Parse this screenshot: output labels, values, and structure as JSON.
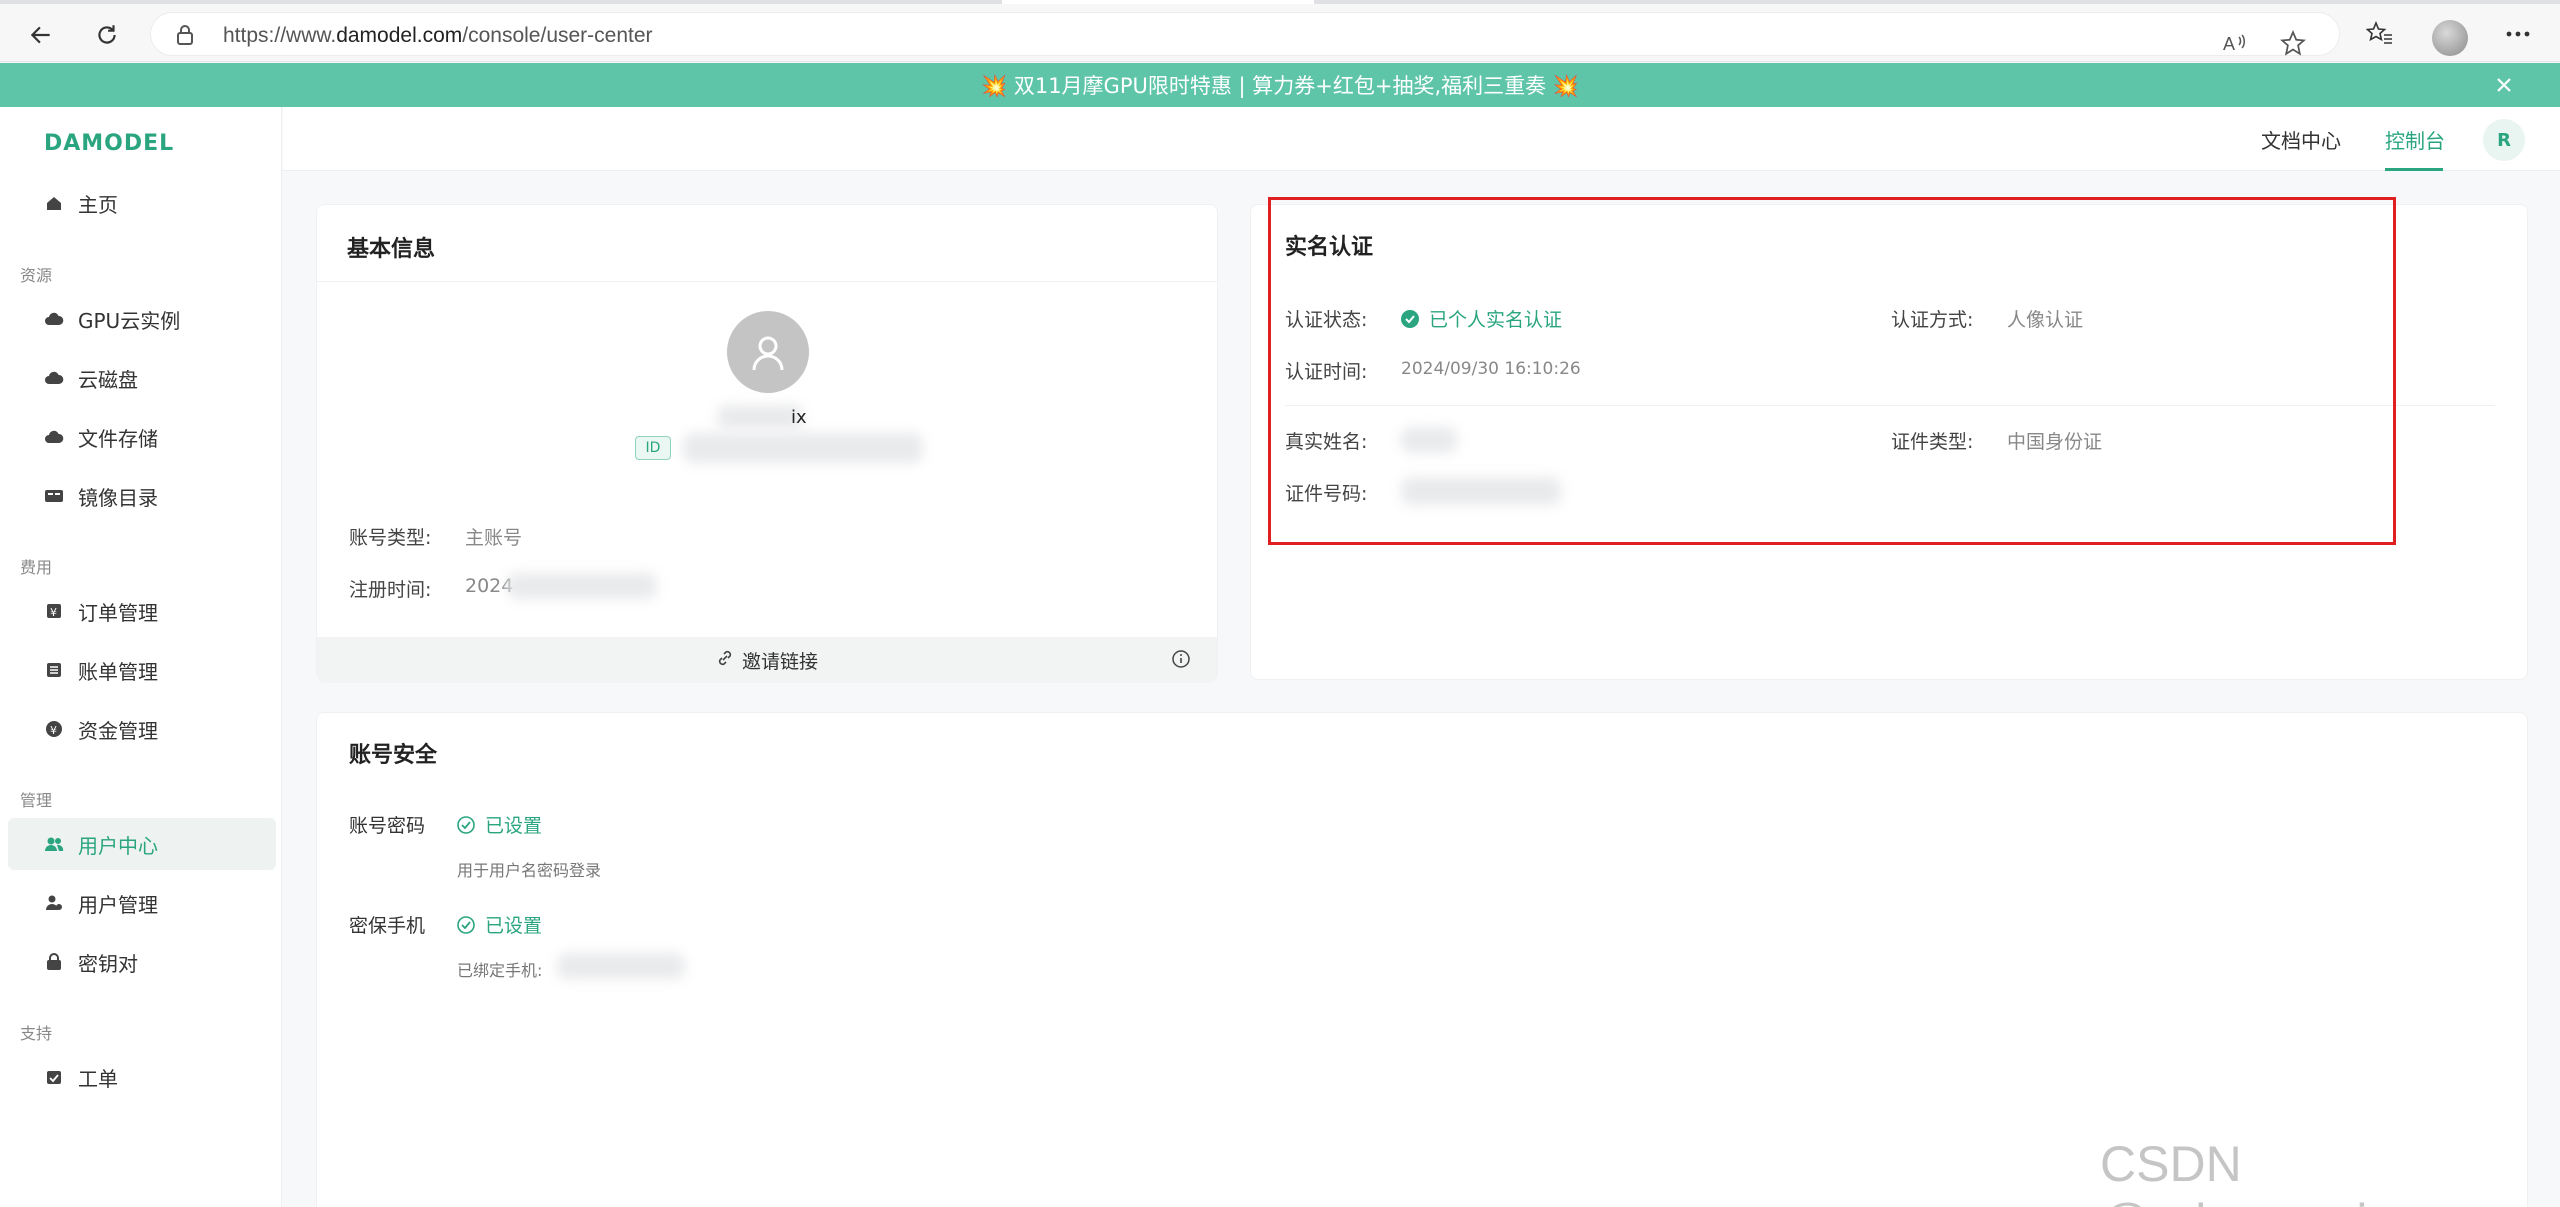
{
  "browser": {
    "url_prefix": "https://www.",
    "url_domain": "damodel.com",
    "url_path": "/console/user-center"
  },
  "banner": {
    "text": "💥 双11月摩GPU限时特惠 | 算力券+红包+抽奖,福利三重奏 💥"
  },
  "sidebar": {
    "logo": "DAMODEL",
    "home": "主页",
    "sections": {
      "resources": "资源",
      "fees": "费用",
      "manage": "管理",
      "support": "支持"
    },
    "items": {
      "gpu": "GPU云实例",
      "disk": "云磁盘",
      "storage": "文件存储",
      "image": "镜像目录",
      "orders": "订单管理",
      "bills": "账单管理",
      "funds": "资金管理",
      "user_center": "用户中心",
      "user_manage": "用户管理",
      "keypair": "密钥对",
      "ticket": "工单"
    }
  },
  "topnav": {
    "docs": "文档中心",
    "console": "控制台",
    "avatar_letter": "R"
  },
  "basic_info": {
    "title": "基本信息",
    "username_suffix": "ix",
    "id_badge": "ID",
    "account_type_label": "账号类型:",
    "account_type_value": "主账号",
    "register_time_label": "注册时间:",
    "register_time_value": "2024",
    "invite_link": "邀请链接"
  },
  "realname": {
    "title": "实名认证",
    "status_label": "认证状态:",
    "status_value": "已个人实名认证",
    "method_label": "认证方式:",
    "method_value": "人像认证",
    "time_label": "认证时间:",
    "time_value": "2024/09/30 16:10:26",
    "name_label": "真实姓名:",
    "cert_type_label": "证件类型:",
    "cert_type_value": "中国身份证",
    "cert_no_label": "证件号码:"
  },
  "security": {
    "title": "账号安全",
    "password_label": "账号密码",
    "password_status": "已设置",
    "password_hint": "用于用户名密码登录",
    "phone_label": "密保手机",
    "phone_status": "已设置",
    "phone_hint": "已绑定手机:"
  },
  "watermark": "CSDN @relax_spring",
  "colors": {
    "accent": "#2aa57f",
    "banner": "#5ec5a8",
    "highlight_box": "#e02020"
  }
}
